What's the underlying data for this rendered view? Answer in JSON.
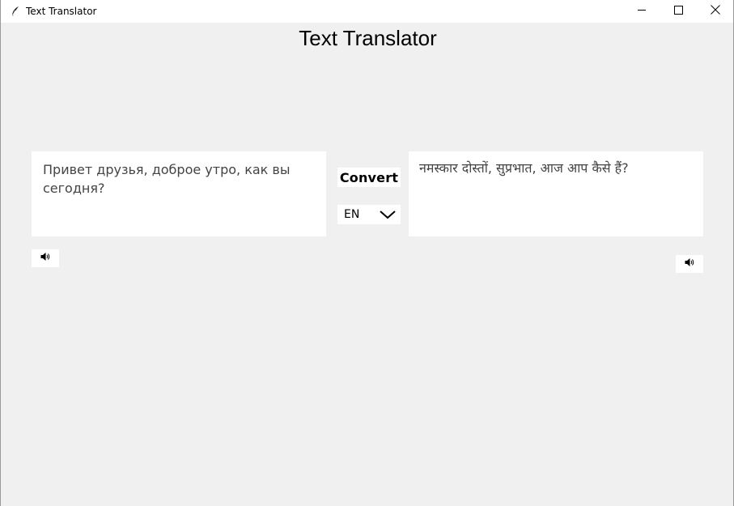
{
  "window": {
    "title": "Text Translator",
    "app_icon": "feather-icon",
    "controls": [
      "minimize-icon",
      "maximize-icon",
      "close-icon"
    ]
  },
  "heading": "Text Translator",
  "source": {
    "text": "Привет друзья, доброе утро, как вы сегодня?"
  },
  "output": {
    "text": "नमस्कार दोस्तों, सुप्रभात, आज आप कैसे हैं?"
  },
  "convert_label": "Convert",
  "language": {
    "selected": "EN"
  },
  "speaker_icon": "speaker-icon"
}
